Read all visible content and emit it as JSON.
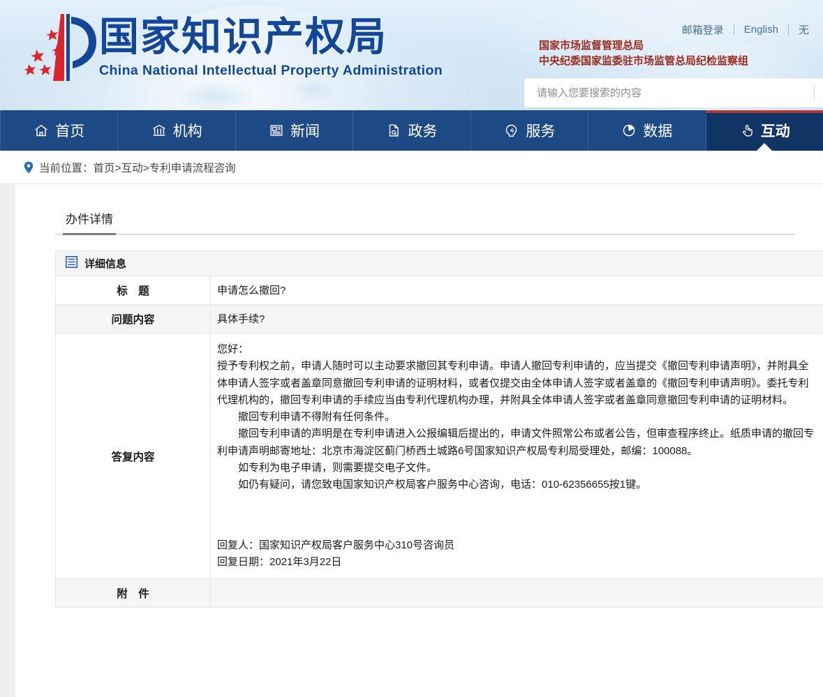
{
  "site": {
    "logo_title_cn": "国家知识产权局",
    "logo_title_en": "China National Intellectual Property Administration",
    "logo_icon": "cnipa-p-logo-icon"
  },
  "header": {
    "top_links": [
      {
        "label": "邮箱登录",
        "name": "mail-login-link"
      },
      {
        "label": "English",
        "name": "english-link"
      },
      {
        "label": "无",
        "name": "accessibility-link"
      }
    ],
    "org_lines": [
      "国家市场监督管理总局",
      "中央纪委国家监委驻市场监管总局纪检监察组"
    ],
    "search": {
      "placeholder": "请输入您要搜索的内容",
      "value": "",
      "button_icon": "search-icon"
    }
  },
  "nav": {
    "items": [
      {
        "label": "首页",
        "icon": "home-icon",
        "active": false
      },
      {
        "label": "机构",
        "icon": "bank-icon",
        "active": false
      },
      {
        "label": "新闻",
        "icon": "newspaper-icon",
        "active": false
      },
      {
        "label": "政务",
        "icon": "document-icon",
        "active": false
      },
      {
        "label": "服务",
        "icon": "service-bulb-icon",
        "active": false
      },
      {
        "label": "数据",
        "icon": "pie-chart-icon",
        "active": false
      },
      {
        "label": "互动",
        "icon": "hand-click-icon",
        "active": true
      }
    ]
  },
  "breadcrumb": {
    "icon": "location-pin-icon",
    "prefix": "当前位置：",
    "path": "首页>互动>专利申请流程咨询"
  },
  "main": {
    "tab_label": "办件详情",
    "section": {
      "icon": "list-panel-icon",
      "title": "详细信息"
    },
    "rows": [
      {
        "label": "标　题",
        "value": "申请怎么撤回?"
      },
      {
        "label": "问题内容",
        "value": "具体手续?"
      }
    ],
    "answer": {
      "label": "答复内容",
      "paragraphs": [
        "您好：",
        "授予专利权之前，申请人随时可以主动要求撤回其专利申请。申请人撤回专利申请的，应当提交《撤回专利申请声明》，并附具全体申请人签字或者盖章同意撤回专利申请的证明材料，或者仅提交由全体申请人签字或者盖章的《撤回专利申请声明》。委托专利代理机构的，撤回专利申请的手续应当由专利代理机构办理，并附具全体申请人签字或者盖章同意撤回专利申请的证明材料。",
        "撤回专利申请不得附有任何条件。",
        "撤回专利申请的声明是在专利申请进入公报编辑后提出的，申请文件照常公布或者公告，但审查程序终止。纸质申请的撤回专利申请声明邮寄地址：北京市海淀区蓟门桥西土城路6号国家知识产权局专利局受理处，邮编：100088。",
        "如专利为电子申请，则需要提交电子文件。",
        "如仍有疑问，请您致电国家知识产权局客户服务中心咨询，电话：010-62356655按1键。"
      ],
      "responder": "回复人：国家知识产权局客户服务中心310号咨询员",
      "reply_date": "回复日期：2021年3月22日"
    },
    "attachment": {
      "label": "附　件",
      "value": ""
    }
  },
  "colors": {
    "nav_bg": "#1d4a85",
    "nav_active_bg": "#103564",
    "nav_active_top": "#b03a35",
    "brand_blue": "#12479a",
    "org_red": "#9c2a1e",
    "header_bg": "#d4e7f6"
  }
}
